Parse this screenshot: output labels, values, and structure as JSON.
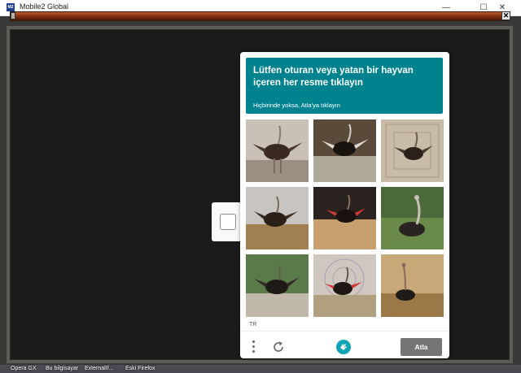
{
  "window": {
    "title": "Mobile2 Global",
    "icon": "app-icon",
    "minimize": "—",
    "maximize": "☐",
    "close": "✕"
  },
  "game": {
    "close_symbol": "✕"
  },
  "captcha": {
    "prompt_title": "Lütfen oturan veya yatan bir hayvan içeren her resme tıklayın",
    "prompt_sub": "Hiçbirinde yoksa, Atla'ya tıklayın",
    "language": "TR",
    "skip_label": "Atla",
    "accent": "#00838f",
    "tiles": [
      "ostrich",
      "ostrich",
      "ostrich",
      "ostrich",
      "ostrich",
      "ostrich",
      "ostrich",
      "ostrich",
      "ostrich"
    ]
  },
  "taskbar": [
    "Opera GX",
    "Bu bilgisayar",
    "ExternalIf...",
    "Eski Firefox"
  ]
}
